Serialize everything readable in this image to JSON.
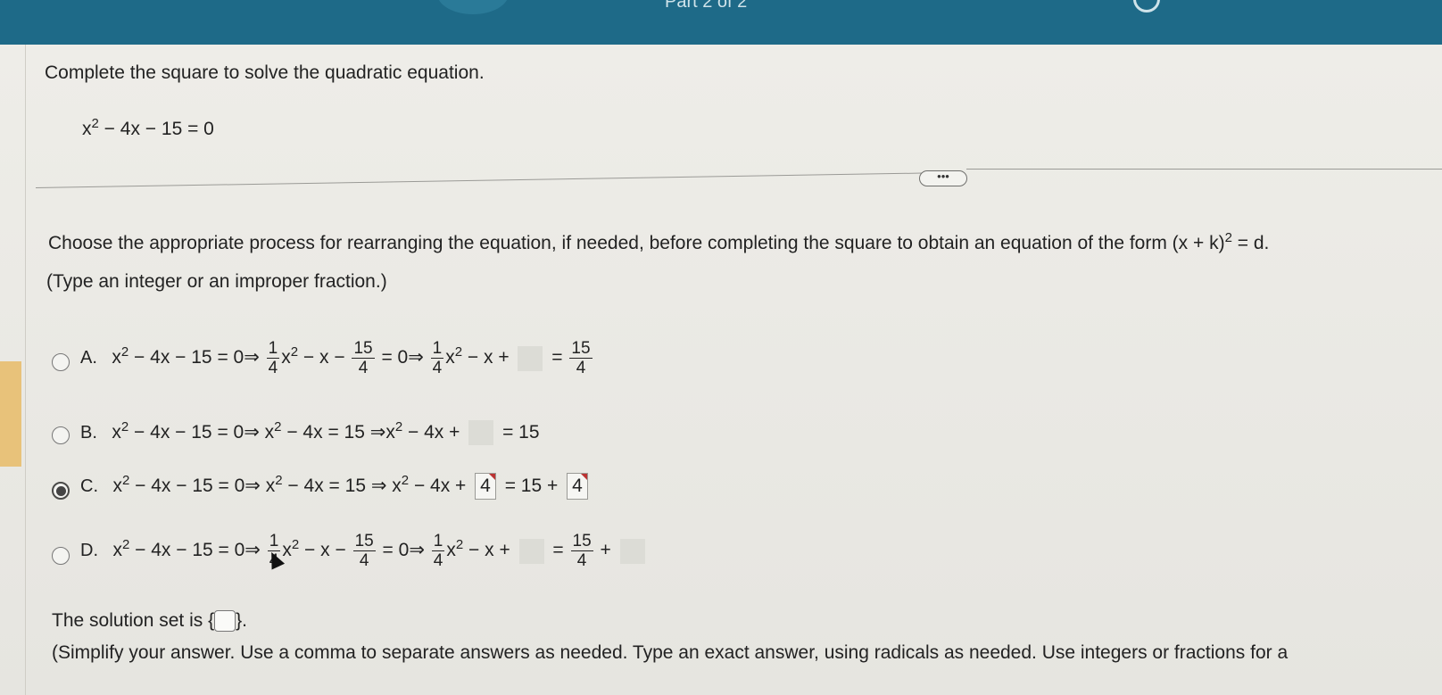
{
  "header": {
    "part_label": "Part 2 of 2"
  },
  "question": {
    "prompt": "Complete the square to solve the quadratic equation.",
    "equation_lhs": "x",
    "equation_sup": "2",
    "equation_rest": " − 4x − 15 = 0"
  },
  "more_button": {
    "label": "•••"
  },
  "instructions": {
    "line1": "Choose the appropriate process for rearranging the equation, if needed, before completing the square to obtain an equation of the form (x + k)",
    "line1_sup": "2",
    "line1_end": " = d.",
    "line2": "(Type an integer or an improper fraction.)"
  },
  "options": {
    "a": {
      "letter": "A.",
      "p1": "x",
      "p1sup": "2",
      "p2": " − 4x − 15 = 0⇒",
      "f1n": "1",
      "f1d": "4",
      "p3": "x",
      "p3sup": "2",
      "p4": " − x −",
      "f2n": "15",
      "f2d": "4",
      "p5": " = 0⇒",
      "f3n": "1",
      "f3d": "4",
      "p6": "x",
      "p6sup": "2",
      "p7": " − x +",
      "p8": " =",
      "f4n": "15",
      "f4d": "4"
    },
    "b": {
      "letter": "B.",
      "p1": "x",
      "p1sup": "2",
      "p2": " − 4x − 15 = 0⇒ x",
      "p2sup": "2",
      "p3": " − 4x = 15 ⇒x",
      "p3sup": "2",
      "p4": " − 4x +",
      "p5": " = 15"
    },
    "c": {
      "letter": "C.",
      "p1": "x",
      "p1sup": "2",
      "p2": " − 4x − 15 = 0⇒ x",
      "p2sup": "2",
      "p3": " − 4x = 15 ⇒ x",
      "p3sup": "2",
      "p4": " − 4x +",
      "box1": "4",
      "p5": " = 15 +",
      "box2": "4"
    },
    "d": {
      "letter": "D.",
      "p1": "x",
      "p1sup": "2",
      "p2": " − 4x − 15 = 0⇒",
      "f1n": "1",
      "f1d": "4",
      "p3": "x",
      "p3sup": "2",
      "p4": " − x −",
      "f2n": "15",
      "f2d": "4",
      "p5": " = 0⇒",
      "f3n": "1",
      "f3d": "4",
      "p6": "x",
      "p6sup": "2",
      "p7": " − x +",
      "p8": " =",
      "f4n": "15",
      "f4d": "4",
      "p9": " +"
    }
  },
  "solution": {
    "label": "The solution set is",
    "open_brace": "{",
    "close_brace": "}.",
    "hint": "(Simplify your answer. Use a comma to separate answers as needed. Type an exact answer, using radicals as needed. Use integers or fractions for a"
  }
}
